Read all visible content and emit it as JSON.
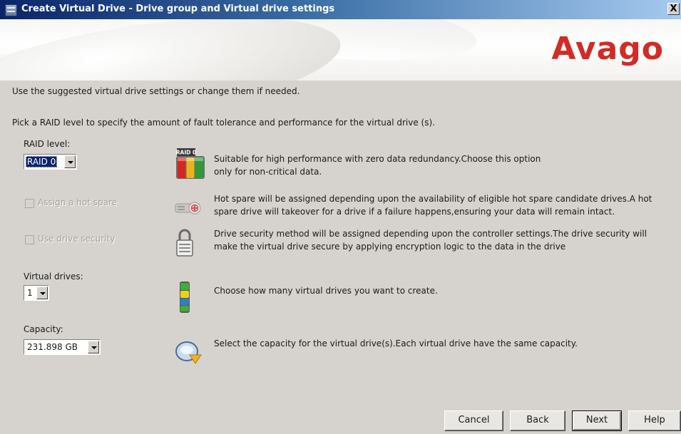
{
  "window": {
    "title": "Create Virtual Drive - Drive group and Virtual drive settings",
    "close_label": "X"
  },
  "banner": {
    "logo": "Avago"
  },
  "intro": {
    "line1": "Use the suggested virtual drive settings or change them if needed.",
    "line2": "Pick a RAID level to specify the amount of fault tolerance and performance for the virtual drive (s)."
  },
  "raid": {
    "label": "RAID level:",
    "value": "RAID 0",
    "icon_badge": "RAID 0",
    "desc1": "Suitable for high performance with zero data redundancy.Choose this option",
    "desc2": "only for non-critical data."
  },
  "hot_spare": {
    "label": "Assign a hot spare",
    "checked": false,
    "enabled": false,
    "desc1": "Hot spare will be assigned depending upon the availability of eligible hot spare candidate drives.A hot",
    "desc2": "spare drive will takeover for a drive if a failure happens,ensuring your data will remain intact."
  },
  "drive_security": {
    "label": "Use drive security",
    "checked": false,
    "enabled": false,
    "desc1": "Drive security method will be assigned depending upon the controller settings.The drive security will",
    "desc2": "make the virtual drive secure by applying encryption logic to the data in the drive"
  },
  "virtual_drives": {
    "label": "Virtual drives:",
    "value": "1",
    "desc": "Choose how many virtual drives you want to create."
  },
  "capacity": {
    "label": "Capacity:",
    "value": "231.898 GB",
    "desc": "Select the capacity for the virtual drive(s).Each virtual drive have the same capacity."
  },
  "buttons": {
    "cancel": "Cancel",
    "back": "Back",
    "next": "Next",
    "help": "Help"
  },
  "colors": {
    "logo": "#d22b26",
    "selection": "#0a246a",
    "dialog_bg": "#d6d3ce"
  }
}
